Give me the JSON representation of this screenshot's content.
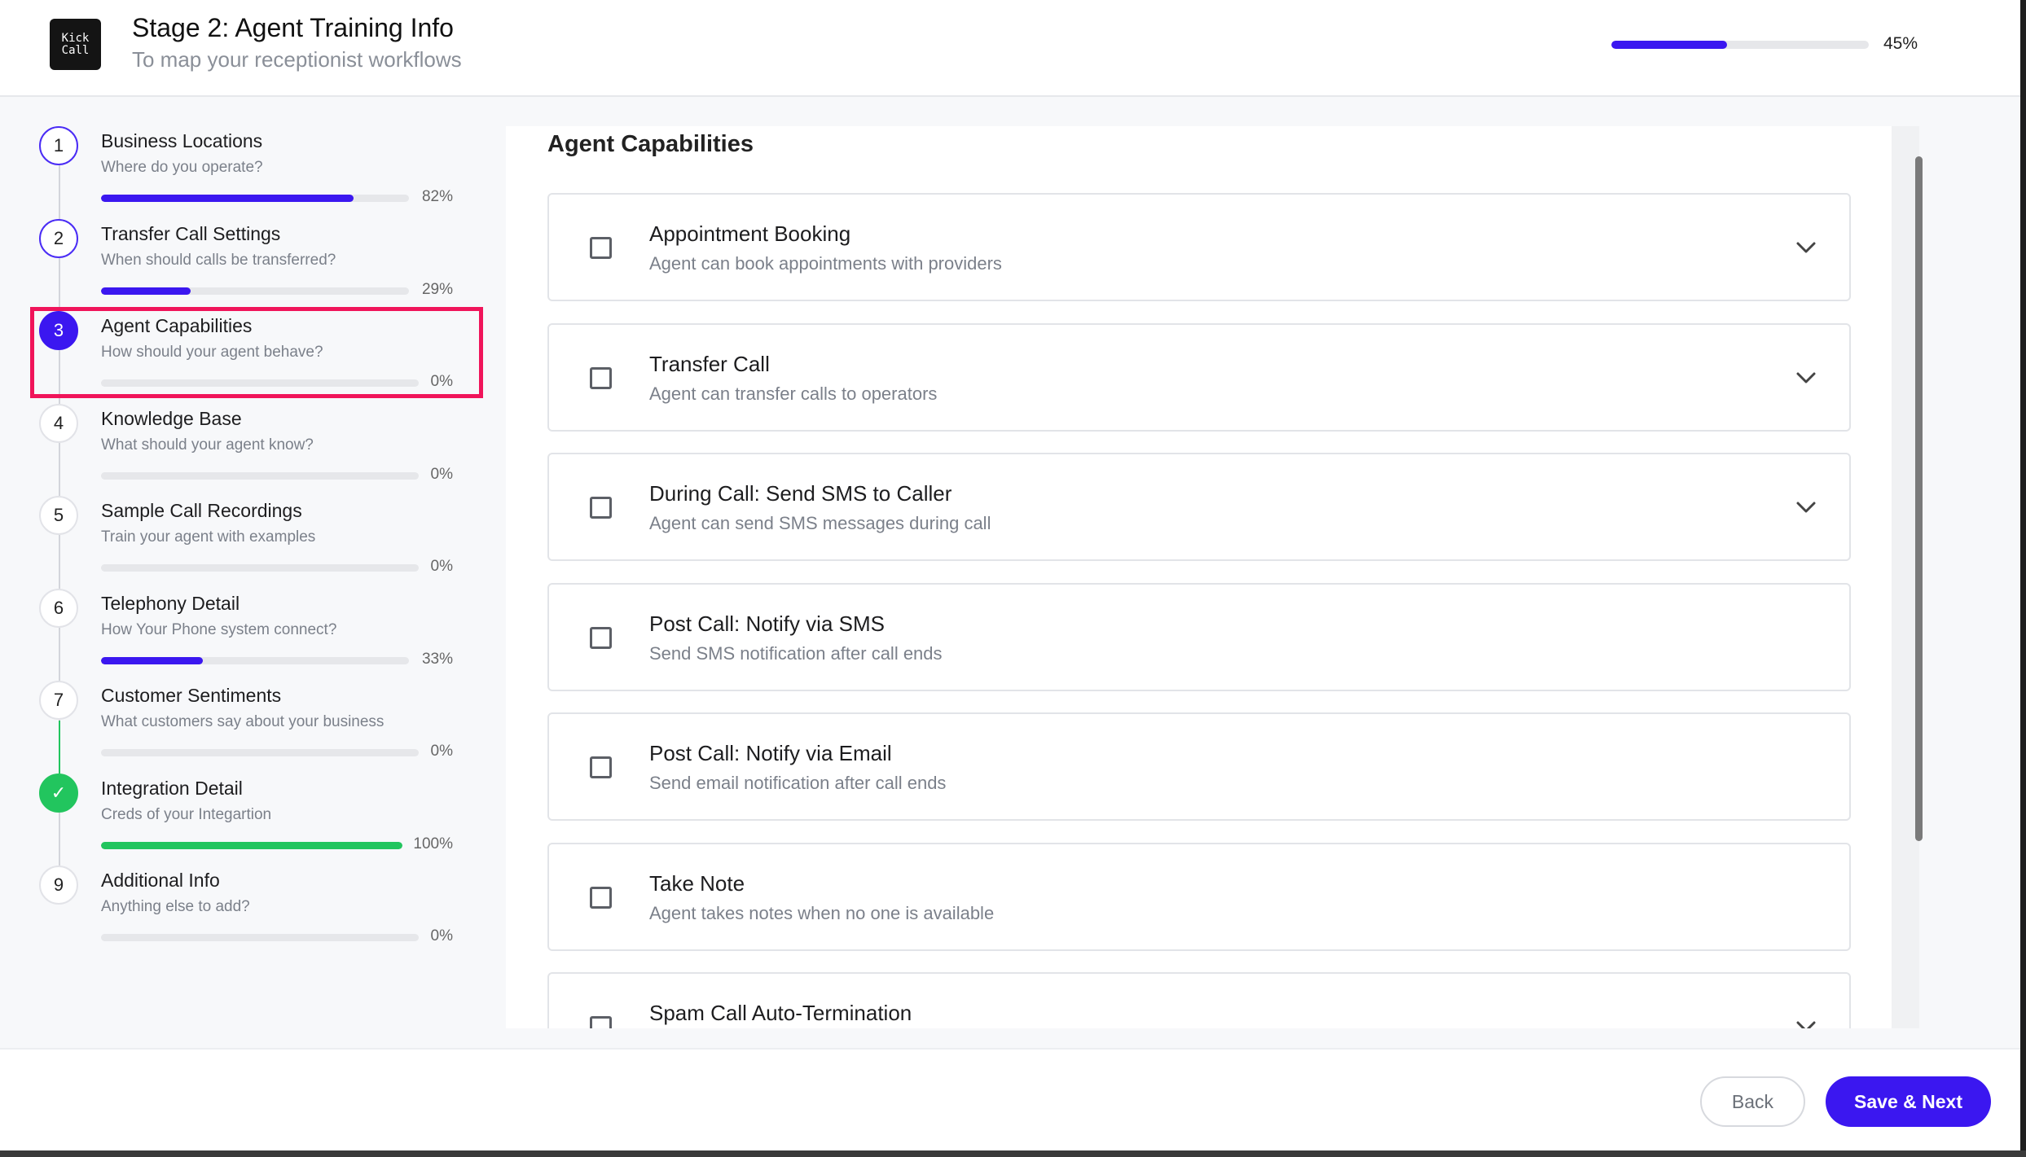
{
  "header": {
    "logo_line1": "Kick",
    "logo_line2": "Call",
    "title": "Stage 2: Agent Training Info",
    "subtitle": "To map your receptionist workflows",
    "progress_percent": 45,
    "progress_label": "45%"
  },
  "sidebar": {
    "steps": [
      {
        "number": "1",
        "title": "Business Locations",
        "subtitle": "Where do you operate?",
        "progress": 82,
        "progress_label": "82%",
        "state": "started"
      },
      {
        "number": "2",
        "title": "Transfer Call Settings",
        "subtitle": "When should calls be transferred?",
        "progress": 29,
        "progress_label": "29%",
        "state": "started"
      },
      {
        "number": "3",
        "title": "Agent Capabilities",
        "subtitle": "How should your agent behave?",
        "progress": 0,
        "progress_label": "0%",
        "state": "active"
      },
      {
        "number": "4",
        "title": "Knowledge Base",
        "subtitle": "What should your agent know?",
        "progress": 0,
        "progress_label": "0%",
        "state": "pending"
      },
      {
        "number": "5",
        "title": "Sample Call Recordings",
        "subtitle": "Train your agent with examples",
        "progress": 0,
        "progress_label": "0%",
        "state": "pending"
      },
      {
        "number": "6",
        "title": "Telephony Detail",
        "subtitle": "How Your Phone system connect?",
        "progress": 33,
        "progress_label": "33%",
        "state": "pending"
      },
      {
        "number": "7",
        "title": "Customer Sentiments",
        "subtitle": "What customers say about your business",
        "progress": 0,
        "progress_label": "0%",
        "state": "pending"
      },
      {
        "number": "✓",
        "title": "Integration Detail",
        "subtitle": "Creds of your Integartion",
        "progress": 100,
        "progress_label": "100%",
        "state": "complete"
      },
      {
        "number": "9",
        "title": "Additional Info",
        "subtitle": "Anything else to add?",
        "progress": 0,
        "progress_label": "0%",
        "state": "pending"
      }
    ]
  },
  "main": {
    "title": "Agent Capabilities",
    "capabilities": [
      {
        "title": "Appointment Booking",
        "description": "Agent can book appointments with providers",
        "checked": false,
        "expandable": true
      },
      {
        "title": "Transfer Call",
        "description": "Agent can transfer calls to operators",
        "checked": false,
        "expandable": true
      },
      {
        "title": "During Call: Send SMS to Caller",
        "description": "Agent can send SMS messages during call",
        "checked": false,
        "expandable": true
      },
      {
        "title": "Post Call: Notify via SMS",
        "description": "Send SMS notification after call ends",
        "checked": false,
        "expandable": false
      },
      {
        "title": "Post Call: Notify via Email",
        "description": "Send email notification after call ends",
        "checked": false,
        "expandable": false
      },
      {
        "title": "Take Note",
        "description": "Agent takes notes when no one is available",
        "checked": false,
        "expandable": false
      },
      {
        "title": "Spam Call Auto-Termination",
        "description": "",
        "checked": false,
        "expandable": true
      }
    ]
  },
  "footer": {
    "back_label": "Back",
    "next_label": "Save & Next"
  },
  "colors": {
    "accent": "#3b17f0",
    "success": "#22c55e",
    "highlight": "#f0145a"
  },
  "icons": {
    "expand": "chevron-down-icon",
    "complete": "check-icon"
  }
}
